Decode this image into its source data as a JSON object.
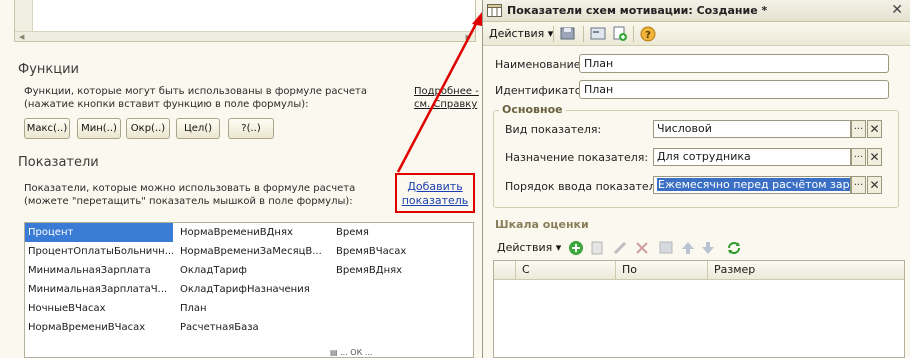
{
  "left": {
    "functions": {
      "title": "Функции",
      "desc_line1": "Функции, которые могут быть использованы в формуле расчета",
      "desc_line2": "(нажатие кнопки вставит функцию в поле формулы):",
      "more_line1": "Подробнее -",
      "more_line2": "см. Справку",
      "buttons": [
        "Макс(..)",
        "Мин(..)",
        "Окр(..)",
        "Цел()",
        "?(..)"
      ]
    },
    "indicators": {
      "title": "Показатели",
      "desc_line1": "Показатели, которые можно использовать в формуле расчета",
      "desc_line2": "(можете \"перетащить\" показатель мышкой в поле формулы):",
      "add_line1": "Добавить",
      "add_line2": "показатель",
      "rows": [
        [
          "Процент",
          "НормаВремениВДнях",
          "Время"
        ],
        [
          "ПроцентОплатыБольничн...",
          "НормаВремениЗаМесяцВ...",
          "ВремяВЧасах"
        ],
        [
          "МинимальнаяЗарплата",
          "ОкладТариф",
          "ВремяВДнях"
        ],
        [
          "МинимальнаяЗарплатаЧ...",
          "ОкладТарифНазначения",
          ""
        ],
        [
          "НочныеВЧасах",
          "План",
          ""
        ],
        [
          "НормаВремениВЧасах",
          "РасчетнаяБаза",
          ""
        ]
      ]
    },
    "bottom_strip": "▤ ...         ОК ..."
  },
  "dialog": {
    "title": "Показатели схем мотивации: Создание *",
    "toolbar": {
      "actions": "Действия"
    },
    "name_label": "Наименование:",
    "name_value": "План",
    "id_label": "Идентификатор:",
    "id_value": "План",
    "group_title": "Основное",
    "type_label": "Вид показателя:",
    "type_value": "Числовой",
    "purpose_label": "Назначение показателя:",
    "purpose_value": "Для сотрудника",
    "order_label": "Порядок ввода показателя:",
    "order_value": "Ежемесячно перед расчётом зарплаты",
    "scale_title": "Шкала оценки",
    "scale_actions": "Действия",
    "scale_columns": [
      "С",
      "По",
      "Размер"
    ]
  },
  "colors": {
    "highlight": "#3a7bd5",
    "annotation_red": "#e00000"
  }
}
